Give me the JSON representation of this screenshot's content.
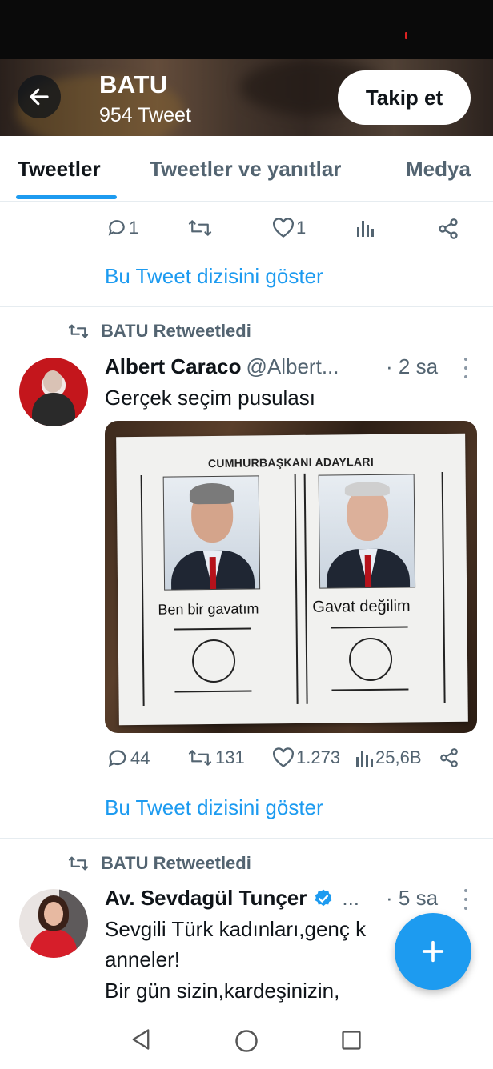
{
  "profile": {
    "name": "BATU",
    "tweet_count": "954 Tweet",
    "follow_label": "Takip et"
  },
  "tabs": [
    {
      "label": "Tweetler",
      "active": true
    },
    {
      "label": "Tweetler ve yanıtlar",
      "active": false
    },
    {
      "label": "Medya",
      "active": false
    }
  ],
  "first_tweet_actions": {
    "replies": "1",
    "retweets": "",
    "likes": "1"
  },
  "show_thread_label": "Bu Tweet dizisini göster",
  "tweets": [
    {
      "retweeted_by": "BATU Retweetledi",
      "author_name": "Albert Caraco",
      "author_handle": "@Albert...",
      "time": "· 2 sa",
      "text": "Gerçek seçim pusulası",
      "media": {
        "title": "CUMHURBAŞKANI ADAYLARI",
        "left_caption": "Ben bir gavatım",
        "right_caption": "Gavat değilim"
      },
      "actions": {
        "replies": "44",
        "retweets": "131",
        "likes": "1.273",
        "views": "25,6B"
      },
      "show_thread": "Bu Tweet dizisini göster"
    },
    {
      "retweeted_by": "BATU Retweetledi",
      "author_name": "Av. Sevdagül Tunçer",
      "author_handle": "...",
      "time": "· 5 sa",
      "verified": true,
      "text_lines": [
        "Sevgili Türk kadınları,genç k",
        "anneler!",
        "Bir gün sizin,kardeşinizin,"
      ]
    }
  ],
  "colors": {
    "accent": "#1d9bf0",
    "text_primary": "#0f1419",
    "text_secondary": "#536471"
  },
  "icons": [
    "back-arrow-icon",
    "reply-icon",
    "retweet-icon",
    "like-icon",
    "views-icon",
    "share-icon",
    "more-icon",
    "verified-badge-icon",
    "compose-plus-icon",
    "nav-back-icon",
    "nav-home-icon",
    "nav-recents-icon"
  ]
}
